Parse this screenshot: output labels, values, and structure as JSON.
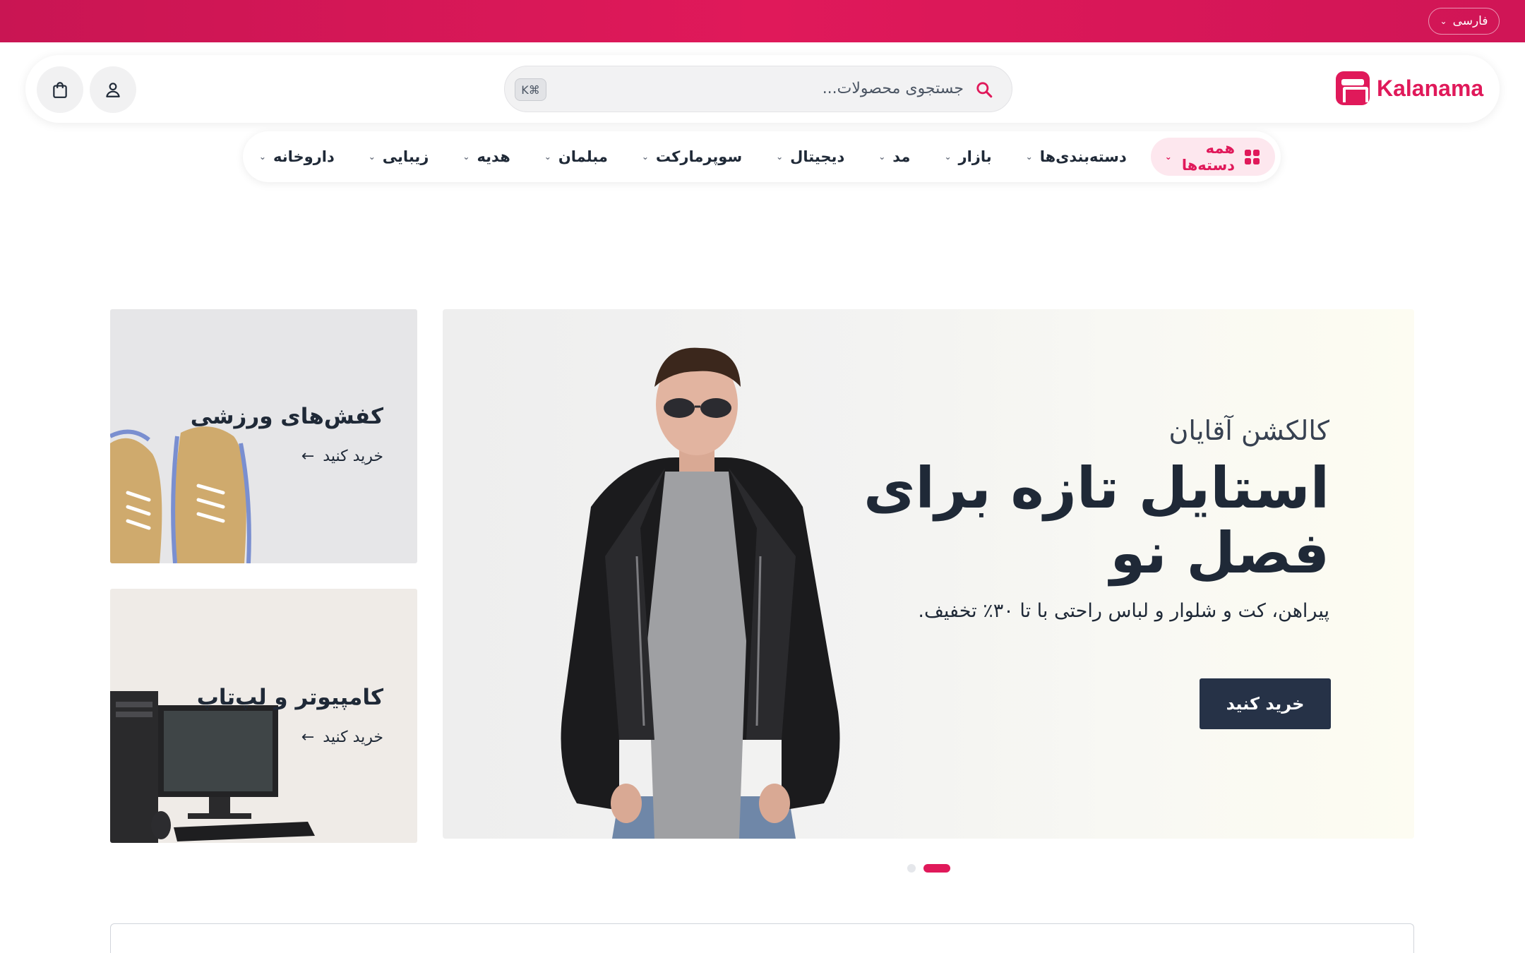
{
  "topbar": {
    "language": "فارسی",
    "chevron_icon": "chevron-down-icon",
    "color": "#e0195a"
  },
  "header": {
    "logo_text": "Kalanama",
    "logo_icon": "store-icon",
    "search": {
      "placeholder": "جستجوی محصولات...",
      "shortcut": "K⌘",
      "icon": "search-icon"
    },
    "user_icon": "user-icon",
    "cart_icon": "shopping-bag-icon"
  },
  "nav": {
    "all_categories": "همه دسته‌ها",
    "items": [
      {
        "label": "دسته‌بندی‌ها"
      },
      {
        "label": "بازار"
      },
      {
        "label": "مد"
      },
      {
        "label": "دیجیتال"
      },
      {
        "label": "سوپرمارکت"
      },
      {
        "label": "مبلمان"
      },
      {
        "label": "هدیه"
      },
      {
        "label": "زیبایی"
      },
      {
        "label": "داروخانه"
      }
    ]
  },
  "hero": {
    "subtitle": "کالکشن آقایان",
    "title_line1": "استایل تازه برای",
    "title_line2": "فصل نو",
    "description": "پیراهن، کت و شلوار و لباس راحتی با تا ۳۰٪ تخفیف.",
    "cta": "خرید کنید",
    "cta_color": "#263247"
  },
  "side_cards": [
    {
      "title": "کفش‌های ورزشی",
      "link": "خرید کنید"
    },
    {
      "title": "کامپیوتر و لپ‌تاپ",
      "link": "خرید کنید"
    }
  ],
  "carousel": {
    "slides": 2,
    "active": 2
  }
}
